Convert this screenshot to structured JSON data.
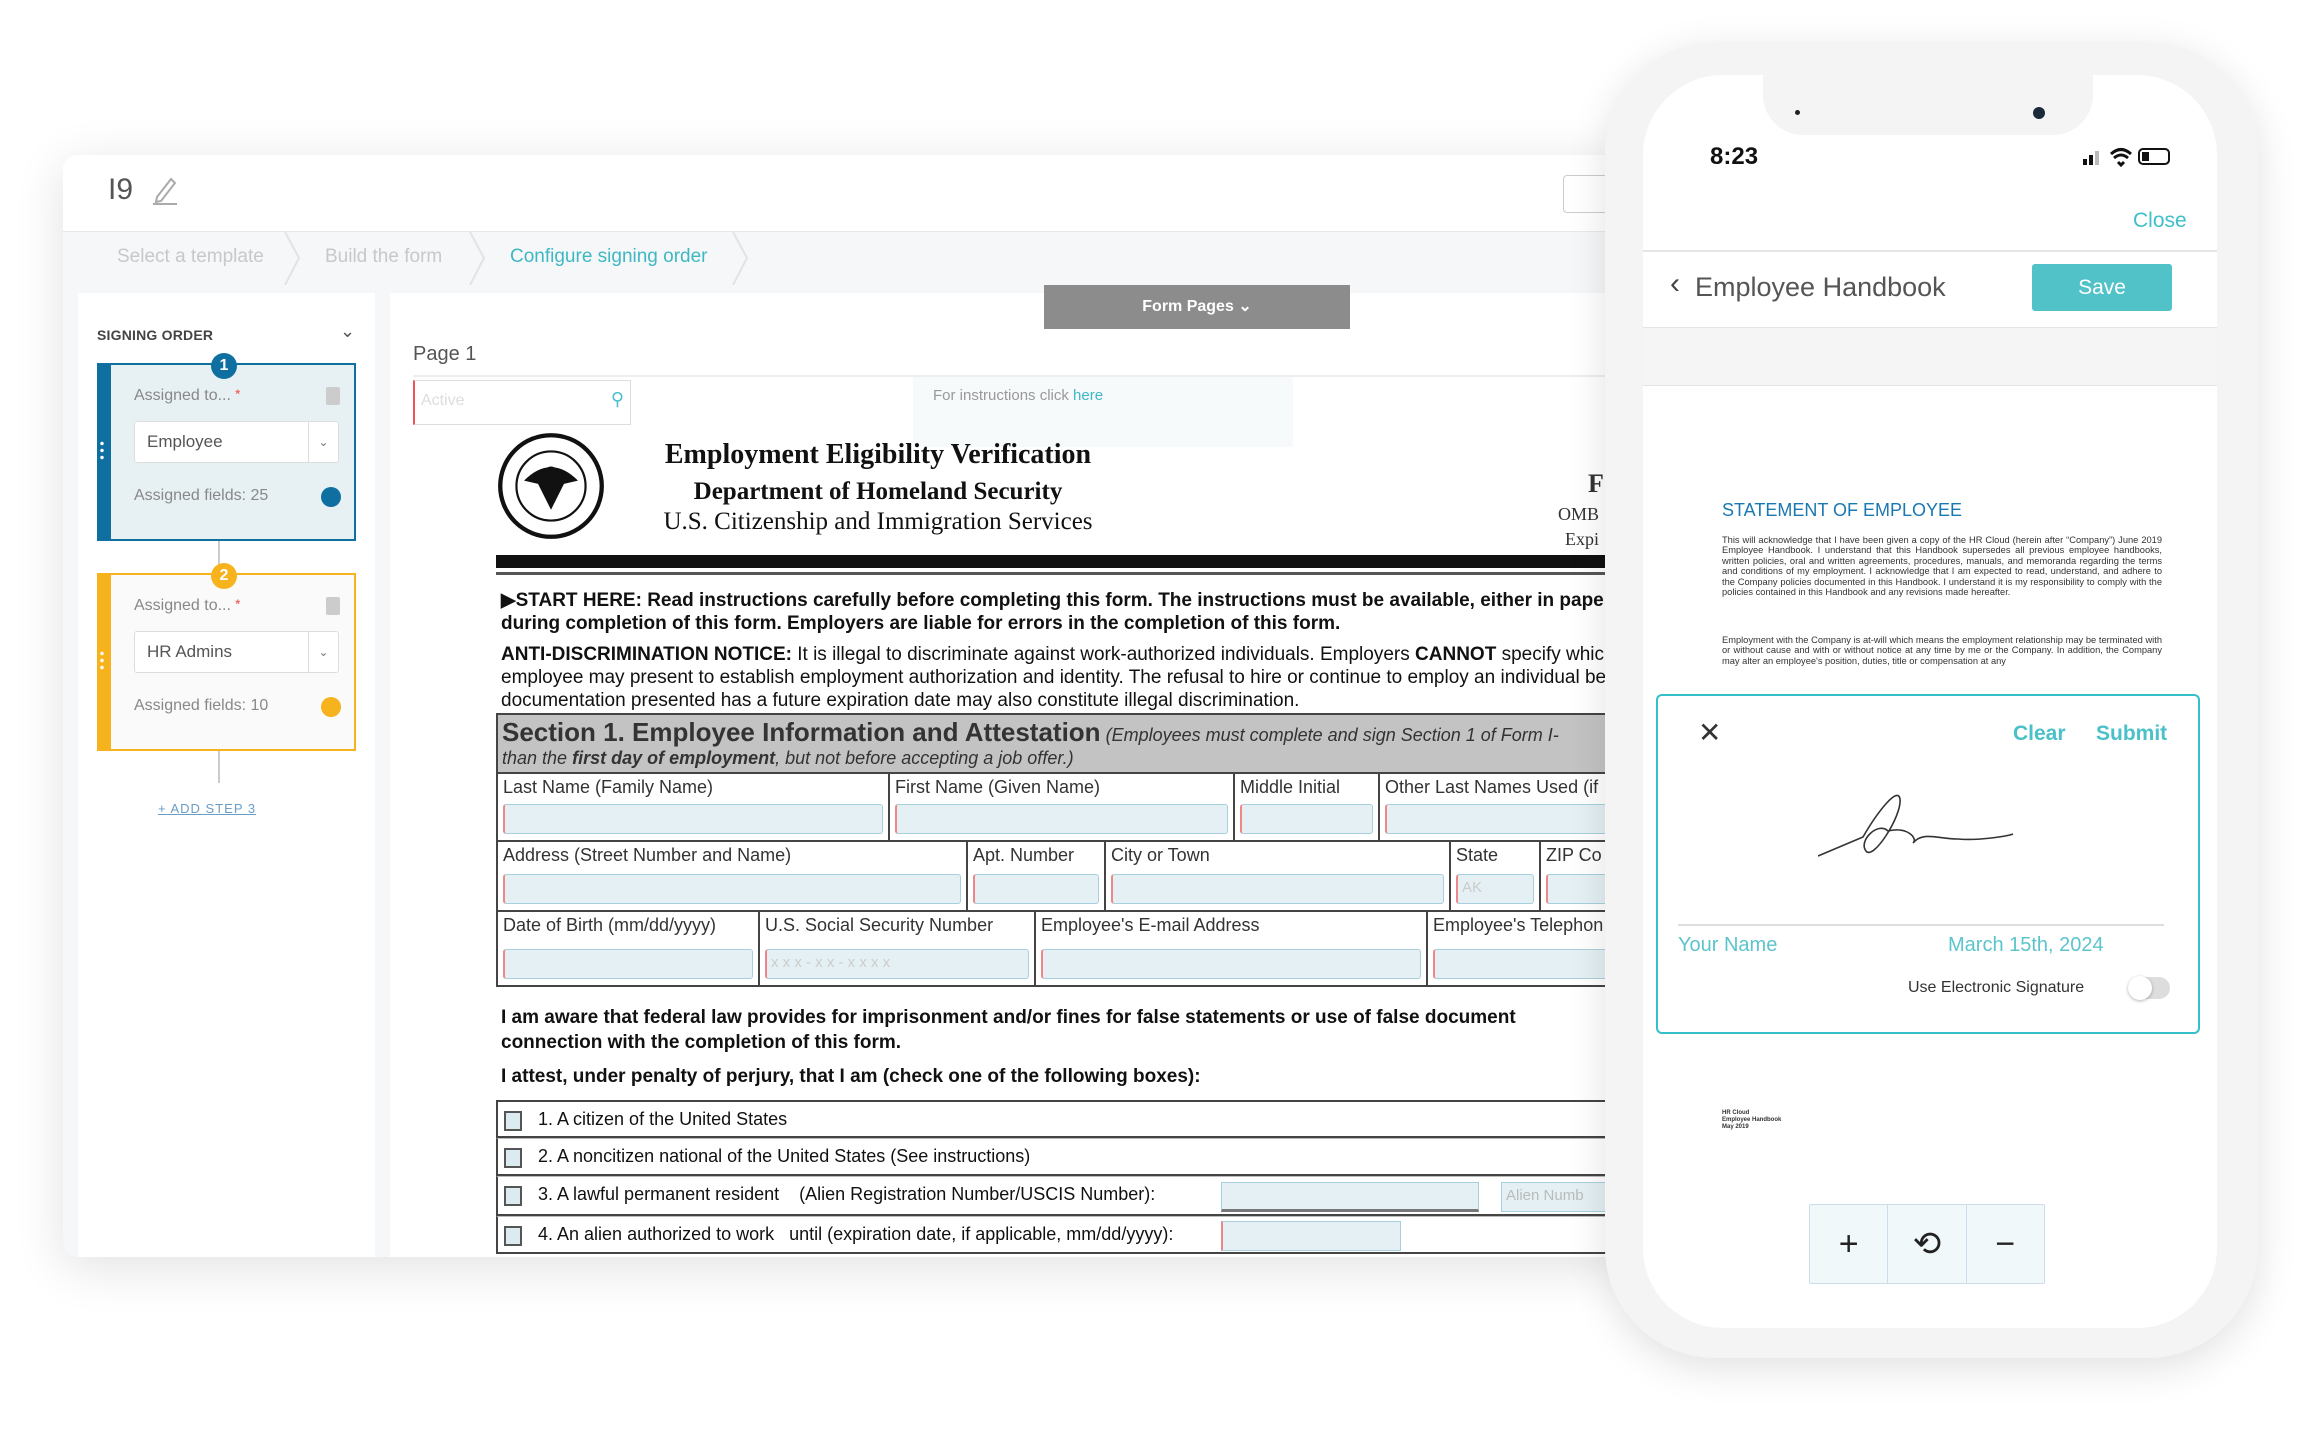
{
  "desktop": {
    "doc_title": "I9",
    "breadcrumbs": [
      {
        "label": "Select a template",
        "active": false
      },
      {
        "label": "Build the form",
        "active": false
      },
      {
        "label": "Configure signing order",
        "active": true
      }
    ],
    "sidebar": {
      "title": "SIGNING ORDER",
      "steps": [
        {
          "number": "1",
          "assigned_label": "Assigned to...",
          "required": "*",
          "assignee": "Employee",
          "fields": "Assigned fields: 25",
          "color": "#0e6fa0"
        },
        {
          "number": "2",
          "assigned_label": "Assigned to...",
          "required": "*",
          "assignee": "HR Admins",
          "fields": "Assigned fields: 10",
          "color": "#f6b31d"
        }
      ],
      "add_step": "ADD STEP 3",
      "add_icon": "+"
    },
    "main": {
      "form_pages": "Form Pages",
      "page_label": "Page 1",
      "search_placeholder": "Active",
      "instructions_prefix": "For instructions click",
      "instructions_link": "here"
    },
    "form": {
      "title": "Employment Eligibility Verification",
      "dept": "Department of Homeland Security",
      "agency": "U.S. Citizenship and Immigration Services",
      "right_f": "F",
      "right_omb": "OMB",
      "right_exp": "Expi",
      "start_here_bold": "START HERE: Read instructions carefully before completing this form. The instructions must be available, either in paper or el",
      "start_here_2": "during completion of this form. Employers are liable for errors in the completion of this form.",
      "anti_label": "ANTI-DISCRIMINATION NOTICE:",
      "anti_1": "It is illegal to discriminate against work-authorized individuals. Employers",
      "anti_cannot": "CANNOT",
      "anti_1b": "specify which docu",
      "anti_2": "employee may present to establish employment authorization and identity. The refusal to hire or continue to employ an individual because",
      "anti_3": "documentation presented has a future expiration date may also constitute illegal discrimination.",
      "section_title": "Section 1. Employee Information and Attestation",
      "section_note": "(Employees must complete and sign Section 1 of Form I-",
      "section_line2a": "than the",
      "section_line2b": "first day of employment",
      "section_line2c": ", but not before accepting a job offer.)",
      "row1": [
        "Last Name (Family Name)",
        "First Name (Given Name)",
        "Middle Initial",
        "Other Last Names Used (if"
      ],
      "row2": [
        "Address (Street Number and Name)",
        "Apt. Number",
        "City or Town",
        "State",
        "ZIP Co"
      ],
      "state_value": "AK",
      "row3": [
        "Date of Birth (mm/dd/yyyy)",
        "U.S. Social Security Number",
        "Employee's E-mail Address",
        "Employee's Telephon"
      ],
      "ssn_placeholder": "x x x - x x - x x x x",
      "aware_1": "I am aware that federal law provides for imprisonment and/or fines for false statements or use of false document",
      "aware_2": "connection with the completion of this form.",
      "attest": "I attest, under penalty of perjury, that I am (check one of the following boxes):",
      "options": [
        "1. A citizen of the United States",
        "2. A noncitizen national of the United States (See instructions)",
        "3. A lawful permanent resident    (Alien Registration Number/USCIS Number):",
        "4. An alien authorized to work   until (expiration date, if applicable, mm/dd/yyyy):"
      ],
      "alien_placeholder": "Alien Numb"
    }
  },
  "phone": {
    "time": "8:23",
    "close": "Close",
    "title": "Employee Handbook",
    "save": "Save",
    "statement_title": "STATEMENT OF EMPLOYEE",
    "para1": "This will acknowledge that I have been given a copy of the HR Cloud (herein after “Company”) June 2019 Employee Handbook. I understand that this Handbook supersedes all previous employee handbooks, written policies, oral and written agreements, procedures, manuals, and memoranda regarding the terms and conditions of my employment. I acknowledge that I am expected to read, understand, and adhere to the Company policies documented in this Handbook. I understand it is my responsibility to comply with the policies contained in this Handbook and any revisions made hereafter.",
    "para2": "Employment with the Company is at-will which means the employment relationship may be terminated with or without cause and with or without notice at any time by me or the Company. In addition, the Company may alter an employee's position, duties, title or compensation at any",
    "sig": {
      "clear": "Clear",
      "submit": "Submit",
      "name": "Your Name",
      "date": "March 15th, 2024",
      "toggle_label": "Use Electronic Signature",
      "toggle_on": false
    },
    "footer": [
      "HR Cloud",
      "Employee Handbook",
      "May 2019"
    ],
    "zoom": {
      "plus": "+",
      "minus": "−"
    },
    "accent": "#52c2c9"
  }
}
